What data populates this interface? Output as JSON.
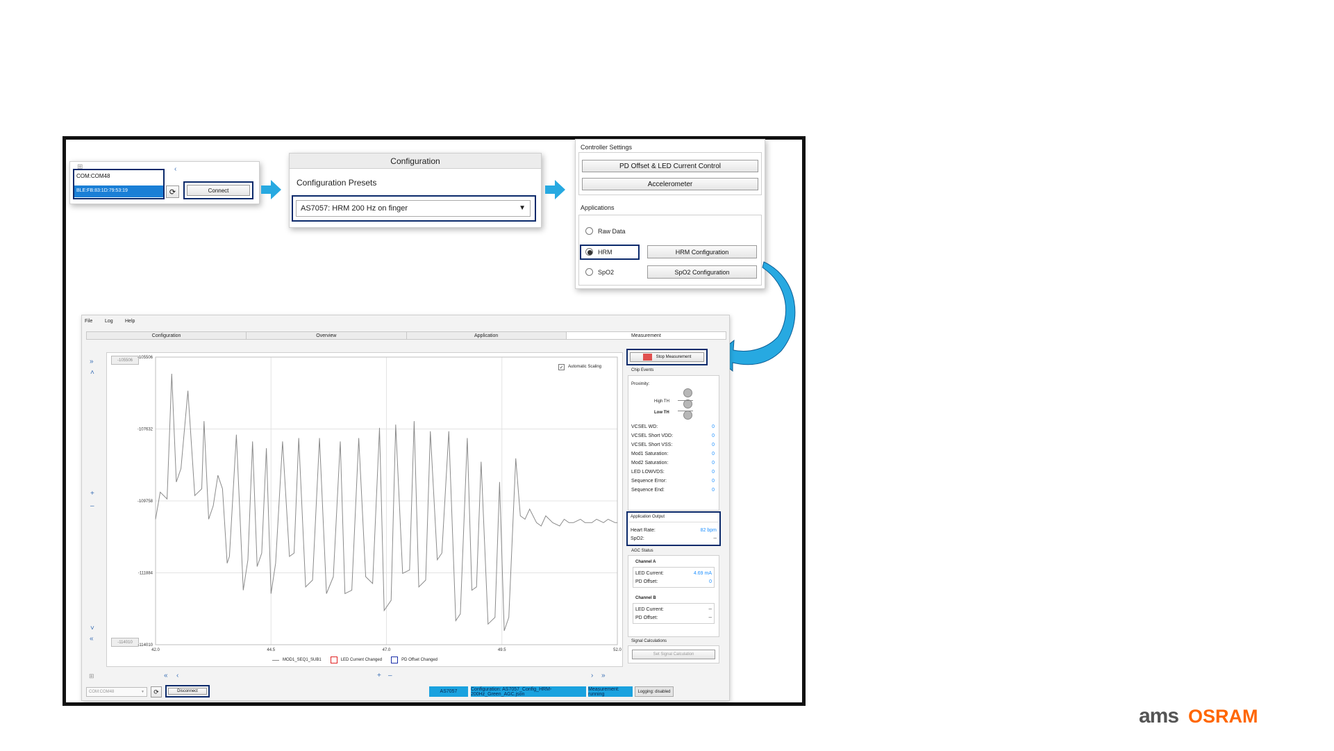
{
  "connect_panel": {
    "device_items": [
      "COM:COM48",
      "BLE:FB:83:1D:79:53:19"
    ],
    "connect_label": "Connect"
  },
  "config_panel": {
    "header": "Configuration",
    "presets_label": "Configuration Presets",
    "preset_value": "AS7057: HRM 200 Hz on finger"
  },
  "controller_panel": {
    "title": "Controller Settings",
    "pd_offset_button": "PD Offset & LED Current Control",
    "accelerometer_button": "Accelerometer",
    "applications_label": "Applications",
    "raw_data_label": "Raw Data",
    "hrm_label": "HRM",
    "hrm_config_button": "HRM Configuration",
    "spo2_label": "SpO2",
    "spo2_config_button": "SpO2 Configuration"
  },
  "app": {
    "menu": [
      "File",
      "Log",
      "Help"
    ],
    "tabs": [
      "Configuration",
      "Overview",
      "Application",
      "Measurement"
    ],
    "max_box": "-105506",
    "min_box": "-114010",
    "auto_scaling_label": "Automatic Scaling",
    "legend": {
      "series": "MOD1_SEQ1_SUB1",
      "led_current": "LED Current Changed",
      "pd_offset": "PD Offset Changed"
    },
    "stop_measurement": "Stop Measurement",
    "chip_events": {
      "title": "Chip Events",
      "proximity": "Proximity:",
      "high_th": "High TH",
      "low_th": "Low TH",
      "flags": [
        {
          "label": "VCSEL WD:",
          "value": "0"
        },
        {
          "label": "VCSEL Short VDD:",
          "value": "0"
        },
        {
          "label": "VCSEL Short VSS:",
          "value": "0"
        },
        {
          "label": "Mod1 Saturation:",
          "value": "0"
        },
        {
          "label": "Mod2 Saturation:",
          "value": "0"
        },
        {
          "label": "LED LOWVDS:",
          "value": "0"
        },
        {
          "label": "Sequence Error:",
          "value": "0"
        },
        {
          "label": "Sequence End:",
          "value": "0"
        }
      ]
    },
    "app_output": {
      "title": "Application Output",
      "heart_rate_label": "Heart Rate:",
      "heart_rate_value": "82 bpm",
      "spo2_label": "SpO2:",
      "spo2_value": "--"
    },
    "agc": {
      "title": "AGC Status",
      "channel_a": "Channel A",
      "a_led_label": "LED Current:",
      "a_led_value": "4.69 mA",
      "a_pd_label": "PD Offset:",
      "a_pd_value": "0",
      "channel_b": "Channel B",
      "b_led_label": "LED Current:",
      "b_led_value": "--",
      "b_pd_label": "PD Offset:",
      "b_pd_value": "--"
    },
    "signal_calc": {
      "title": "Signal Calculations",
      "button": "Set Signal Calculation"
    },
    "bottom": {
      "port_value": "COM:COM48",
      "disconnect": "Disconnect",
      "status": [
        "AS7057",
        "Configuration: AS7057_Config_HRM-200Hz_Green_AGC.json",
        "Measurement: running",
        "Logging: disabled"
      ]
    }
  },
  "brand": {
    "ams": "ams",
    "osram": "OSRAM",
    "osram_color": "#ff6600",
    "ams_color": "#555555"
  },
  "chart_data": {
    "type": "line",
    "x_ticks": [
      "42.0",
      "44.5",
      "47.0",
      "49.5",
      "52.0"
    ],
    "y_ticks": [
      "-105506",
      "-107632",
      "-109758",
      "-111884",
      "-114010"
    ],
    "xlim": [
      42.0,
      52.0
    ],
    "ylim": [
      -114010,
      -105506
    ],
    "series": [
      {
        "name": "MOD1_SEQ1_SUB1",
        "x": [
          42.0,
          42.1,
          42.25,
          42.35,
          42.45,
          42.55,
          42.7,
          42.85,
          43.0,
          43.05,
          43.15,
          43.25,
          43.35,
          43.45,
          43.55,
          43.6,
          43.75,
          43.9,
          44.0,
          44.1,
          44.2,
          44.3,
          44.4,
          44.5,
          44.6,
          44.75,
          44.9,
          45.0,
          45.1,
          45.25,
          45.4,
          45.55,
          45.7,
          45.85,
          46.0,
          46.1,
          46.25,
          46.4,
          46.55,
          46.7,
          46.85,
          46.95,
          47.1,
          47.2,
          47.35,
          47.5,
          47.6,
          47.7,
          47.85,
          47.95,
          48.1,
          48.2,
          48.35,
          48.5,
          48.6,
          48.75,
          48.85,
          48.95,
          49.05,
          49.2,
          49.35,
          49.45,
          49.55,
          49.65,
          49.8,
          49.9,
          50.0,
          50.1,
          50.25,
          50.35,
          50.45,
          50.6,
          50.75,
          50.85,
          50.95,
          51.05,
          51.2,
          51.3,
          51.45,
          51.55,
          51.7,
          51.8,
          51.95,
          52.0
        ],
        "y": [
          -110300,
          -109500,
          -109700,
          -106000,
          -109200,
          -108800,
          -106500,
          -109600,
          -109400,
          -107400,
          -110300,
          -109900,
          -109000,
          -109400,
          -111600,
          -111400,
          -107800,
          -112400,
          -111500,
          -108000,
          -111700,
          -111300,
          -108200,
          -112500,
          -111600,
          -108000,
          -111400,
          -111300,
          -107900,
          -112300,
          -112100,
          -107900,
          -112500,
          -112000,
          -108000,
          -112500,
          -112400,
          -107900,
          -112000,
          -112200,
          -107600,
          -113000,
          -112700,
          -107500,
          -111900,
          -111800,
          -107400,
          -112300,
          -112100,
          -107700,
          -111500,
          -111300,
          -107700,
          -113300,
          -113100,
          -107900,
          -112400,
          -112300,
          -108600,
          -113400,
          -113200,
          -109200,
          -113600,
          -113200,
          -108500,
          -110200,
          -110300,
          -110000,
          -110400,
          -110500,
          -110200,
          -110400,
          -110500,
          -110300,
          -110400,
          -110400,
          -110300,
          -110400,
          -110400,
          -110300,
          -110400,
          -110300,
          -110400,
          -110400
        ]
      }
    ]
  }
}
